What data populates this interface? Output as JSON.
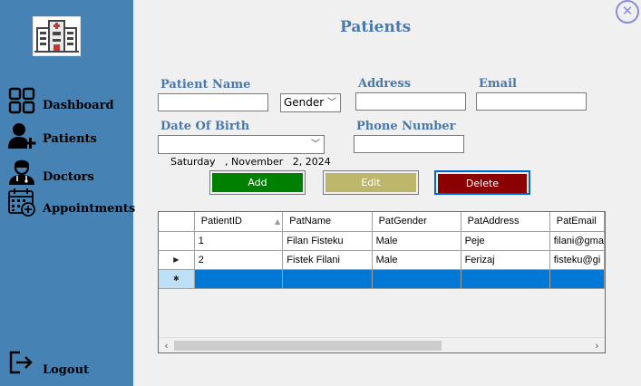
{
  "sidebar": {
    "items": [
      {
        "label": "Dashboard",
        "icon": "dashboard-icon"
      },
      {
        "label": "Patients",
        "icon": "add-user-icon"
      },
      {
        "label": "Doctors",
        "icon": "doctor-icon"
      },
      {
        "label": "Appointments",
        "icon": "calendar-icon"
      }
    ],
    "logout": {
      "label": "Logout",
      "icon": "logout-icon"
    },
    "logo_icon": "hospital-icon"
  },
  "close_icon": "close-icon",
  "page_title": "Patients",
  "form": {
    "patient_name_label": "Patient Name",
    "patient_name_value": "",
    "gender_value": "Gender",
    "address_label": "Address",
    "address_value": "",
    "email_label": "Email",
    "email_value": "",
    "dob_label": "Date Of Birth",
    "dob_value": "Saturday   , November   2, 2024",
    "phone_label": "Phone Number",
    "phone_value": ""
  },
  "buttons": {
    "add": "Add",
    "edit": "Edit",
    "delete": "Delete"
  },
  "grid": {
    "columns": [
      "PatientID",
      "PatName",
      "PatGender",
      "PatAddress",
      "PatEmail"
    ],
    "rows": [
      [
        "1",
        "Filan Fisteku",
        "Male",
        "Peje",
        "filani@gma"
      ],
      [
        "2",
        "Fistek Filani",
        "Male",
        "Ferizaj",
        "fisteku@gi"
      ]
    ]
  },
  "colors": {
    "sidebar": "#4682b4",
    "title": "#4a78a8",
    "add": "#008000",
    "edit": "#bdb76b",
    "delete": "#8b0000",
    "selection": "#0078d7"
  }
}
